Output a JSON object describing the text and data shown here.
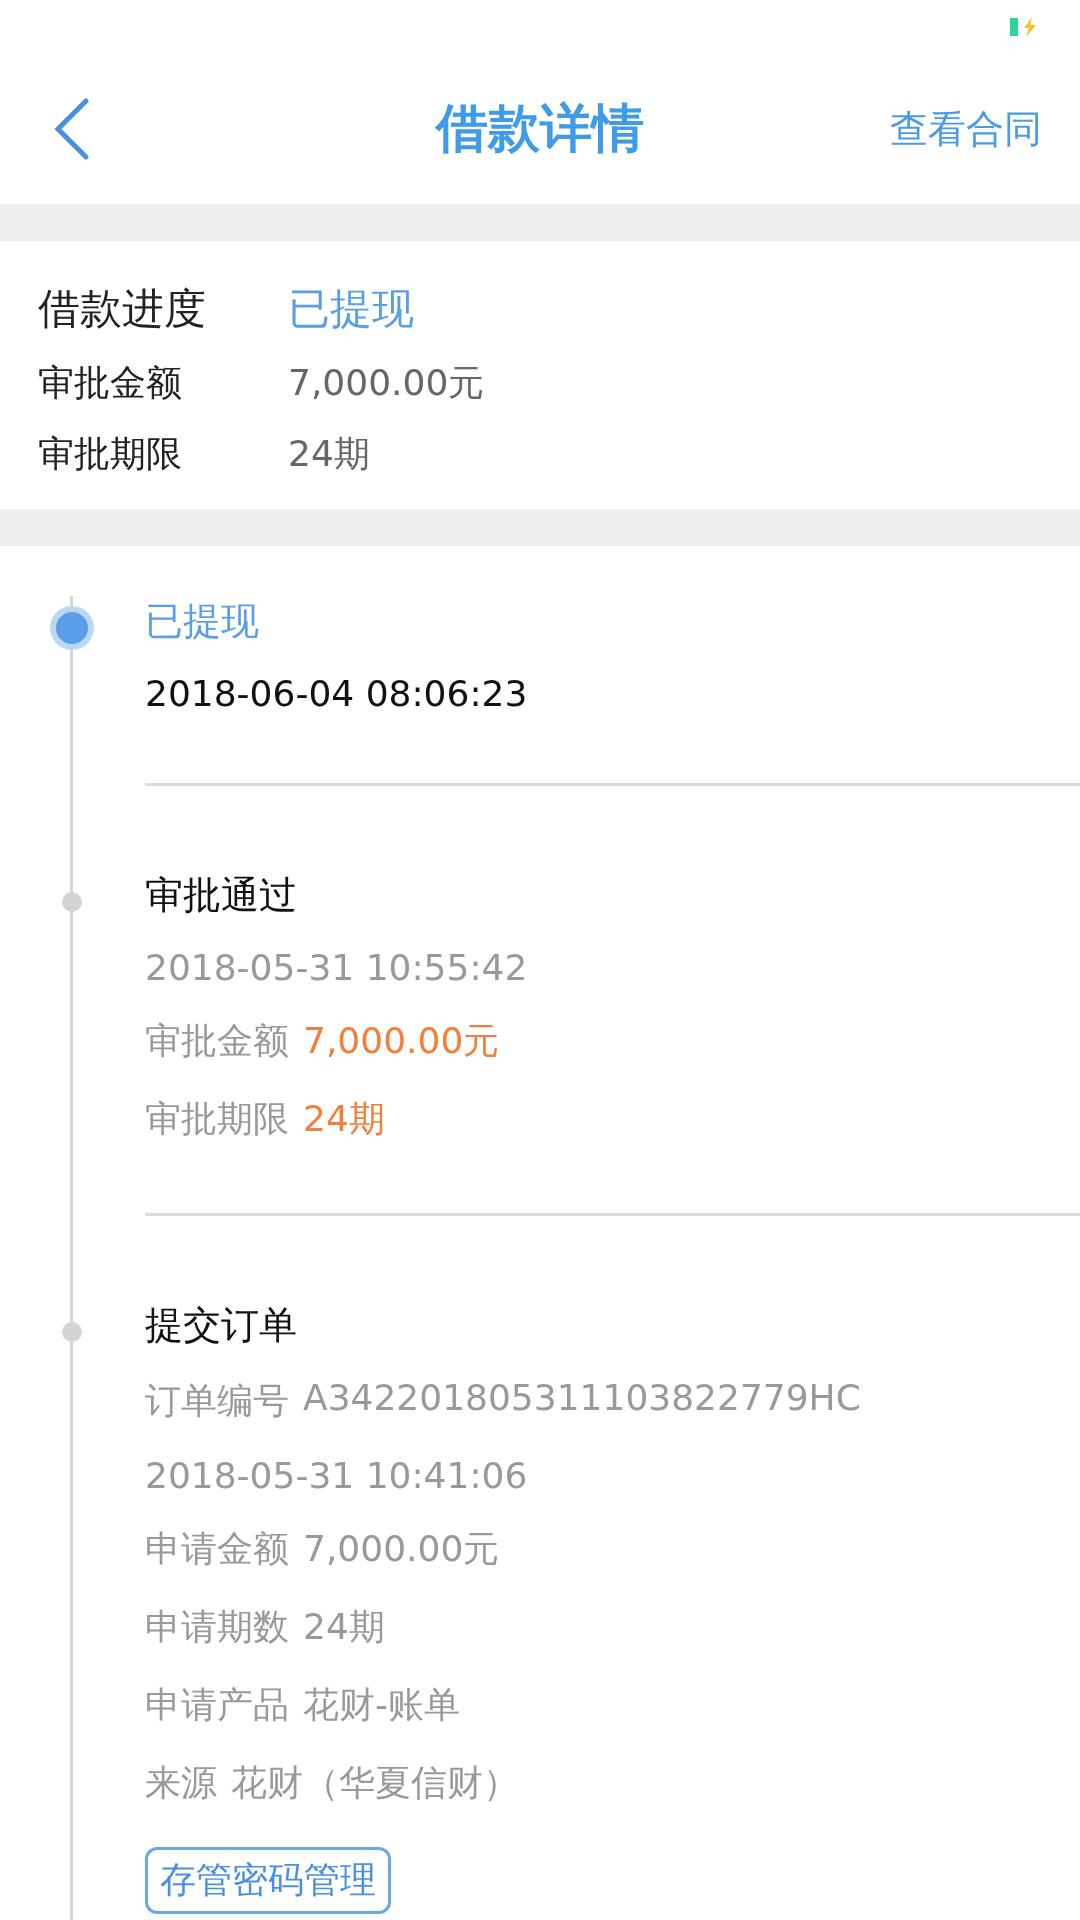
{
  "nav": {
    "title": "借款详情",
    "action": "查看合同"
  },
  "summary": [
    {
      "label": "借款进度",
      "value": "已提现",
      "kind": "status"
    },
    {
      "label": "审批金额",
      "value": "7,000.00元",
      "kind": "plain"
    },
    {
      "label": "审批期限",
      "value": "24期",
      "kind": "plain"
    }
  ],
  "timeline": [
    {
      "title": "已提现",
      "active": true,
      "lines": [
        {
          "kind": "date",
          "text": "2018-06-04 08:06:23"
        }
      ]
    },
    {
      "title": "审批通过",
      "active": false,
      "lines": [
        {
          "kind": "date",
          "text": "2018-05-31 10:55:42"
        },
        {
          "kind": "field",
          "label": "审批金额",
          "value": "7,000.00元",
          "highlight": true
        },
        {
          "kind": "field",
          "label": "审批期限",
          "value": "24期",
          "highlight": true
        }
      ]
    },
    {
      "title": "提交订单",
      "active": false,
      "lines": [
        {
          "kind": "field",
          "label": "订单编号",
          "value": "A342201805311103822779HC",
          "highlight": false
        },
        {
          "kind": "date",
          "text": "2018-05-31 10:41:06"
        },
        {
          "kind": "field",
          "label": "申请金额",
          "value": "7,000.00元",
          "highlight": false
        },
        {
          "kind": "field",
          "label": "申请期数",
          "value": "24期",
          "highlight": false
        },
        {
          "kind": "field",
          "label": "申请产品",
          "value": "花财-账单",
          "highlight": false
        },
        {
          "kind": "field",
          "label": "来源",
          "value": "花财（华夏信财）",
          "highlight": false
        }
      ],
      "button": "存管密码管理"
    }
  ]
}
